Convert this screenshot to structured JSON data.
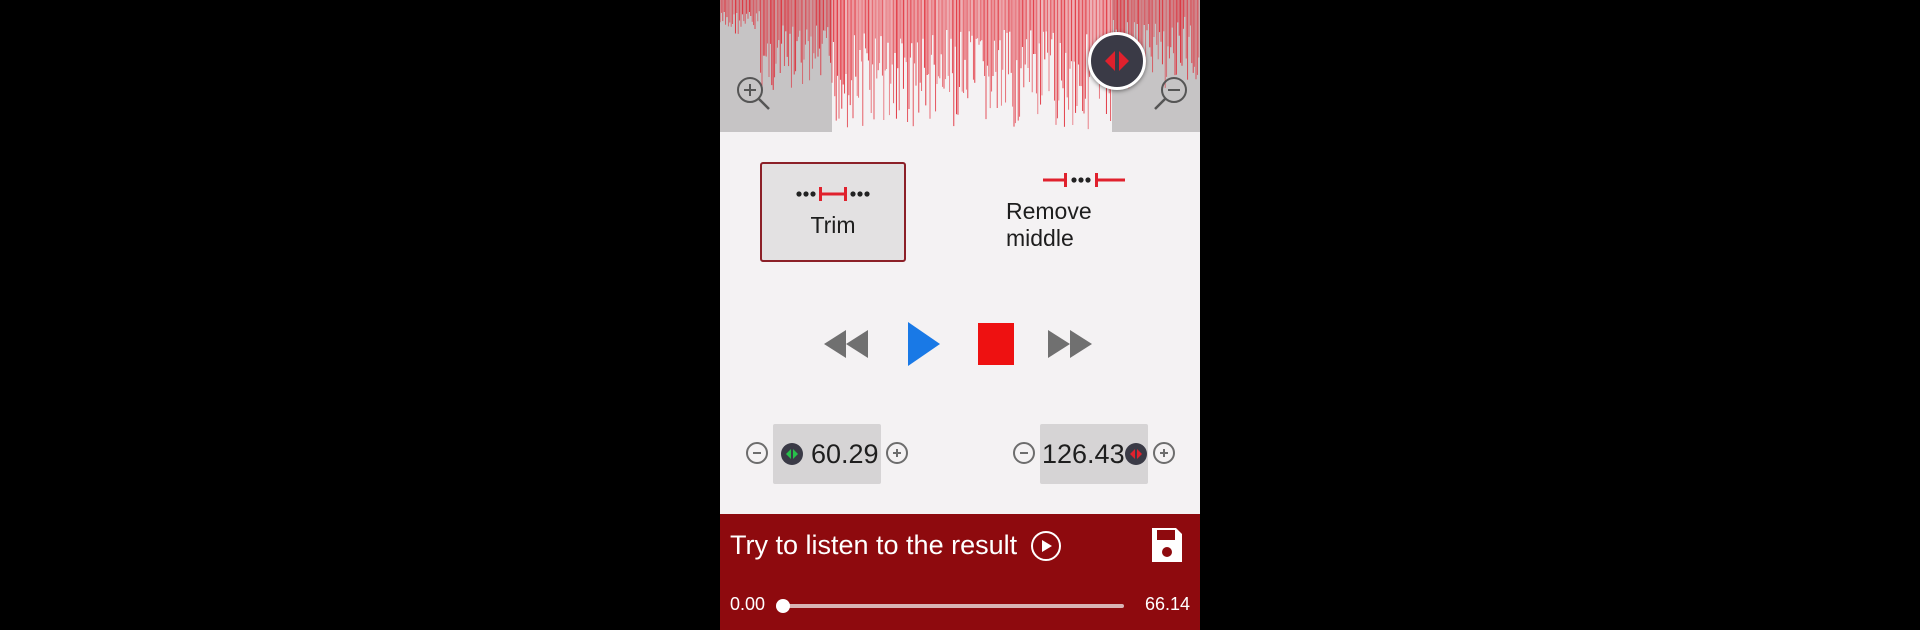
{
  "colors": {
    "accent_red": "#e0212d",
    "bar_red": "#8e0a0e",
    "play_blue": "#1979e6",
    "stop_red": "#ee1111",
    "knob_dark": "#3a3a46"
  },
  "waveform": {
    "zoom_in_icon": "zoom-in-icon",
    "zoom_out_icon": "zoom-out-icon",
    "marker_icon": "marker-handle-icon"
  },
  "modes": {
    "trim_label": "Trim",
    "remove_middle_label": "Remove middle",
    "selected": "Trim"
  },
  "transport": {
    "icons": [
      "rewind-icon",
      "play-icon",
      "stop-icon",
      "fast-forward-icon"
    ]
  },
  "times": {
    "start": "60.29",
    "end": "126.43"
  },
  "preview": {
    "try_label": "Try to listen to the result",
    "current_time": "0.00",
    "total_time": "66.14",
    "progress_fraction": 0.0
  }
}
